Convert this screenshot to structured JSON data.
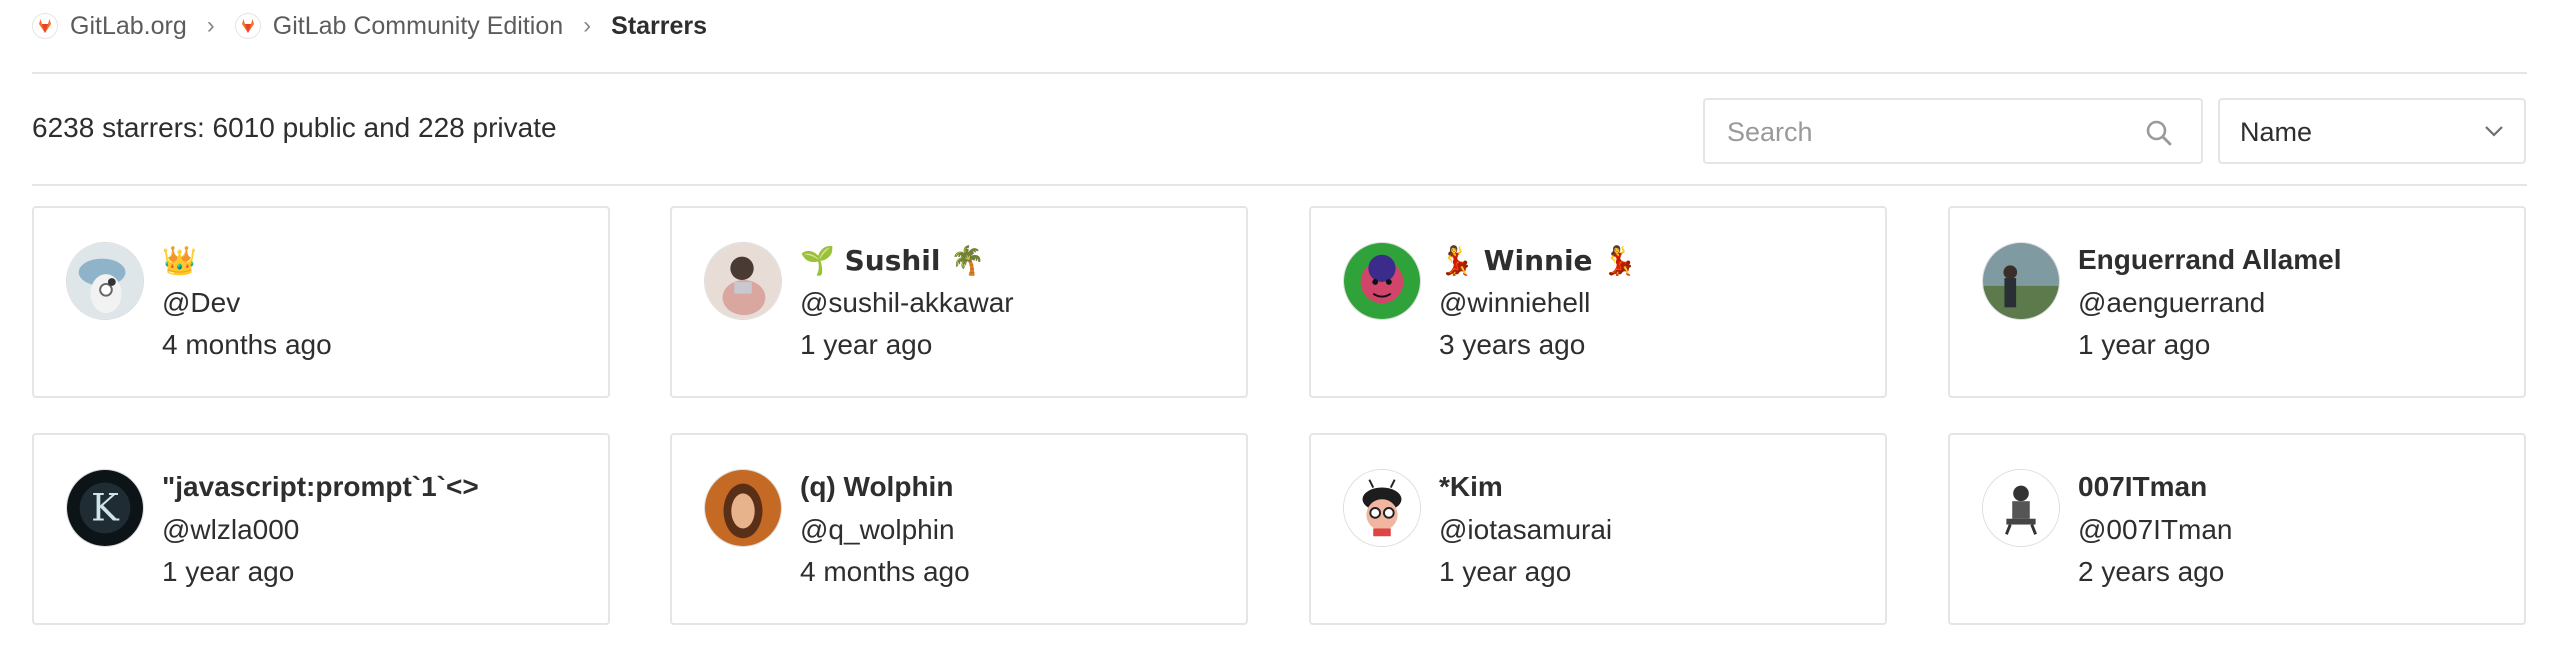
{
  "breadcrumb": {
    "items": [
      {
        "label": "GitLab.org"
      },
      {
        "label": "GitLab Community Edition"
      }
    ],
    "separator": "›",
    "current": "Starrers"
  },
  "summary": {
    "count_text": "6238 starrers: 6010 public and 228 private"
  },
  "search": {
    "placeholder": "Search",
    "value": ""
  },
  "sort": {
    "selected": "Name"
  },
  "colors": {
    "border": "#e5e5e5",
    "text": "#2e2e2e",
    "gitlab_orange": "#fc6d26",
    "gitlab_red": "#e24329"
  },
  "starrers": [
    {
      "name": "👑",
      "username": "@Dev",
      "since": "4 months ago",
      "avatar": "avatar-dev"
    },
    {
      "name": "🌱 Sushil 🌴",
      "username": "@sushil-akkawar",
      "since": "1 year ago",
      "avatar": "avatar-sushil"
    },
    {
      "name": "💃 Winnie 💃",
      "username": "@winniehell",
      "since": "3 years ago",
      "avatar": "avatar-winnie"
    },
    {
      "name": "Enguerrand Allamel",
      "username": "@aenguerrand",
      "since": "1 year ago",
      "avatar": "avatar-enguerrand"
    },
    {
      "name": "\"javascript:prompt`1`<>",
      "username": "@wlzla000",
      "since": "1 year ago",
      "avatar": "avatar-k"
    },
    {
      "name": "(q) Wolphin",
      "username": "@q_wolphin",
      "since": "4 months ago",
      "avatar": "avatar-wolphin"
    },
    {
      "name": "*Kim",
      "username": "@iotasamurai",
      "since": "1 year ago",
      "avatar": "avatar-kim"
    },
    {
      "name": "007ITman",
      "username": "@007ITman",
      "since": "2 years ago",
      "avatar": "avatar-007"
    }
  ]
}
